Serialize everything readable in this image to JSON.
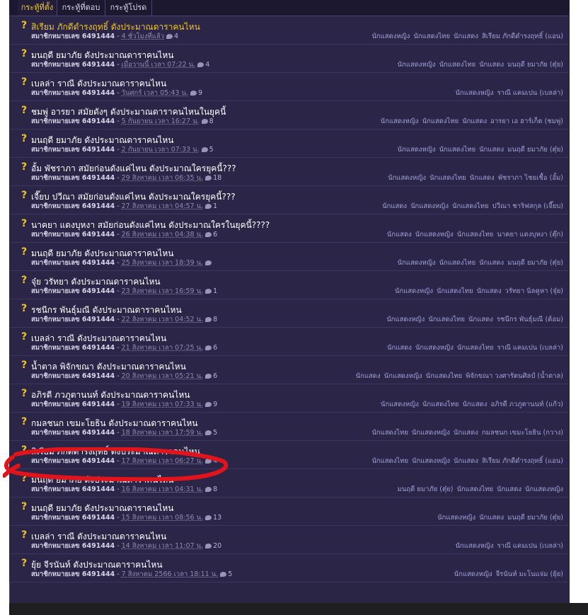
{
  "tabs": [
    "กระทู้ที่ตั้ง",
    "กระทู้ที่ตอบ",
    "กระทู้โปรด"
  ],
  "rows": [
    {
      "title": "สิเรียม ภักดีดำรงฤทธิ์ ดังประมาณดาราคนไหน",
      "member": "สมาชิกหมายเลข 6491444",
      "date": "4 ชั่วโมงที่แล้ว",
      "comments": "4",
      "tags": [
        "นักแสดงหญิง",
        "นักแสดงไทย",
        "นักแสดง",
        "สิเรียม ภักดีดำรงฤทธิ์ (แอน)"
      ]
    },
    {
      "title": "มนฤดี ยมาภัย ดังประมาณดาราคนไหน",
      "member": "สมาชิกหมายเลข 6491444",
      "date": "เมื่อวานนี้ เวลา 07:22 น.",
      "comments": "4",
      "tags": [
        "นักแสดงหญิง",
        "นักแสดงไทย",
        "นักแสดง",
        "มนฤดี ยมาภัย (ตุ๋ย)"
      ]
    },
    {
      "title": "เบลล่า ราณี ดังประมาณดาราคนไหน",
      "member": "สมาชิกหมายเลข 6491444",
      "date": "วันศุกร์ เวลา 05:43 น.",
      "comments": "9",
      "tags": [
        "นักแสดงหญิง",
        "ราณี แคมเปน (เบลล่า)"
      ]
    },
    {
      "title": "ชมพู่ อารยา สมัยดังๆ ดังประมาณดาราคนไหนในยุคนี้",
      "member": "สมาชิกหมายเลข 6491444",
      "date": "5 กันยายน เวลา 16:27 น.",
      "comments": "8",
      "tags": [
        "นักแสดงหญิง",
        "นักแสดงไทย",
        "นักแสดง",
        "อารยา เอ ฮาร์เก็ต (ชมพู่)"
      ]
    },
    {
      "title": "มนฤดี ยมาภัย ดังประมาณดาราคนไหน",
      "member": "สมาชิกหมายเลข 6491444",
      "date": "2 กันยายน เวลา 07:33 น.",
      "comments": "5",
      "tags": [
        "นักแสดงหญิง",
        "นักแสดงไทย",
        "นักแสดง",
        "มนฤดี ยมาภัย (ตุ๋ย)"
      ]
    },
    {
      "title": "อั้ม พัชราภา สมัยก่อนดังแค่ไหน ดังประมาณใครยุคนี้???",
      "member": "สมาชิกหมายเลข 6491444",
      "date": "29 สิงหาคม เวลา 06:35 น.",
      "comments": "18",
      "tags": [
        "นักแสดงหญิง",
        "นักแสดงไทย",
        "นักแสดง",
        "พัชราภา ไชยเชื้อ (อั้ม)"
      ]
    },
    {
      "title": "เจี๊ยบ ปวีณา สมัยก่อนดังแค่ไหน ดังประมาณใครยุคนี้???",
      "member": "สมาชิกหมายเลข 6491444",
      "date": "27 สิงหาคม เวลา 04:57 น.",
      "comments": "1",
      "tags": [
        "นักแสดง",
        "นักแสดงหญิง",
        "นักแสดงไทย",
        "ปวีณา ชาริฟสกุล (เจี๊ยบ)"
      ]
    },
    {
      "title": "นาคยา แดงบุหงา สมัยก่อนดังแค่ไหน ดังประมาณใครในยุคนี้????",
      "member": "สมาชิกหมายเลข 6491444",
      "date": "26 สิงหาคม เวลา 04:38 น.",
      "comments": "6",
      "tags": [
        "นักแสดง",
        "นักแสดงหญิง",
        "นักแสดงไทย",
        "นาคยา แดงบุหงา (ตุ๊ก)"
      ]
    },
    {
      "title": "มนฤดี ยมาภัย ดังประมาณดาราคนไหน",
      "member": "สมาชิกหมายเลข 6491444",
      "date": "25 สิงหาคม เวลา 18:39 น.",
      "comments": "",
      "tags": [
        "นักแสดงหญิง",
        "นักแสดงไทย",
        "นักแสดง",
        "มนฤดี ยมาภัย (ตุ๋ย)"
      ]
    },
    {
      "title": "จุ๋ย วรัทยา ดังประมาณดาราคนไหน",
      "member": "สมาชิกหมายเลข 6491444",
      "date": "23 สิงหาคม เวลา 16:59 น.",
      "comments": "1",
      "tags": [
        "นักแสดงหญิง",
        "นักแสดงไทย",
        "นักแสดง",
        "วรัทยา นิลคูหา (จุ๋ย)"
      ]
    },
    {
      "title": "รชนีกร พันธุ์มณี ดังประมาณดาราคนไหน",
      "member": "สมาชิกหมายเลข 6491444",
      "date": "22 สิงหาคม เวลา 04:52 น.",
      "comments": "8",
      "tags": [
        "นักแสดงหญิง",
        "นักแสดงไทย",
        "นักแสดง",
        "รชนีกร พันธุ์มณี (ต้อม)"
      ]
    },
    {
      "title": "เบลล่า ราณี ดังประมาณดาราคนไหน",
      "member": "สมาชิกหมายเลข 6491444",
      "date": "21 สิงหาคม เวลา 07:25 น.",
      "comments": "6",
      "tags": [
        "นักแสดง",
        "นักแสดงหญิง",
        "นักแสดงไทย",
        "ราณี แคมเปน (เบลล่า)"
      ]
    },
    {
      "title": "น้ำตาล พิจักขณา ดังประมาณดาราคนไหน",
      "member": "สมาชิกหมายเลข 6491444",
      "date": "20 สิงหาคม เวลา 05:21 น.",
      "comments": "6",
      "tags": [
        "นักแสดง",
        "นักแสดงหญิง",
        "นักแสดงไทย",
        "พิจักขณา วงศารัตนศิลป์ (น้ำตาล)"
      ]
    },
    {
      "title": "อภิรดี ภวภูตานนท์ ดังประมาณดาราคนไหน",
      "member": "สมาชิกหมายเลข 6491444",
      "date": "19 สิงหาคม เวลา 07:33 น.",
      "comments": "9",
      "tags": [
        "นักแสดงหญิง",
        "นักแสดงไทย",
        "นักแสดง",
        "อภิรดี ภวภูตานนท์ (แก้ว)"
      ]
    },
    {
      "title": "กมลชนก เขมะโยธิน ดังประมาณดาราคนไหน",
      "member": "สมาชิกหมายเลข 6491444",
      "date": "18 สิงหาคม เวลา 17:59 น.",
      "comments": "5",
      "tags": [
        "นักแสดงไทย",
        "นักแสดงหญิง",
        "นักแสดง",
        "กมลชนก เขมะโยธิน (กวาง)"
      ]
    },
    {
      "title": "สิเรียม ภักดีดำรงฤทธิ์ ดังประมาณดาราคนไหน",
      "member": "สมาชิกหมายเลข 6491444",
      "date": "17 สิงหาคม เวลา 06:27 น.",
      "comments": "4",
      "tags": [
        "นักแสดงไทย",
        "นักแสดงหญิง",
        "นักแสดง",
        "สิเรียม ภักดีดำรงฤทธิ์ (แอน)"
      ]
    },
    {
      "title": "มนฤดี ยมาภัย ดังประมาณดาราคนไหน",
      "member": "สมาชิกหมายเลข 6491444",
      "date": "16 สิงหาคม เวลา 04:31 น.",
      "comments": "8",
      "tags": [
        "มนฤดี ยมาภัย (ตุ๋ย)",
        "นักแสดงไทย",
        "นักแสดง",
        "นักแสดงหญิง"
      ]
    },
    {
      "title": "มนฤดี ยมาภัย ดังประมาณดาราคนไหน",
      "member": "สมาชิกหมายเลข 6491444",
      "date": "15 สิงหาคม เวลา 08:56 น.",
      "comments": "13",
      "tags": [
        "นักแสดงหญิง",
        "นักแสดง",
        "มนฤดี ยมาภัย (ตุ๋ย)"
      ]
    },
    {
      "title": "เบลล่า ราณี ดังประมาณดาราคนไหน",
      "member": "สมาชิกหมายเลข 6491444",
      "date": "14 สิงหาคม เวลา 11:07 น.",
      "comments": "20",
      "tags": [
        "นักแสดงหญิง",
        "ราณี แคมเปน (เบลล่า)"
      ]
    },
    {
      "title": "ยุ้ย จีรนันท์ ดังประมาณดาราคนไหน",
      "member": "สมาชิกหมายเลข 6491444",
      "date": "7 สิงหาคม 2566 เวลา 18:11 น.",
      "comments": "5",
      "tags": [
        "นักแสดงหญิง",
        "จีรนันท์ มะโนแจ่ม (ยุ้ย)"
      ]
    }
  ],
  "colors": {
    "panel": "#2b2647",
    "accent": "#f2c524",
    "annotation": "#e0141c"
  }
}
